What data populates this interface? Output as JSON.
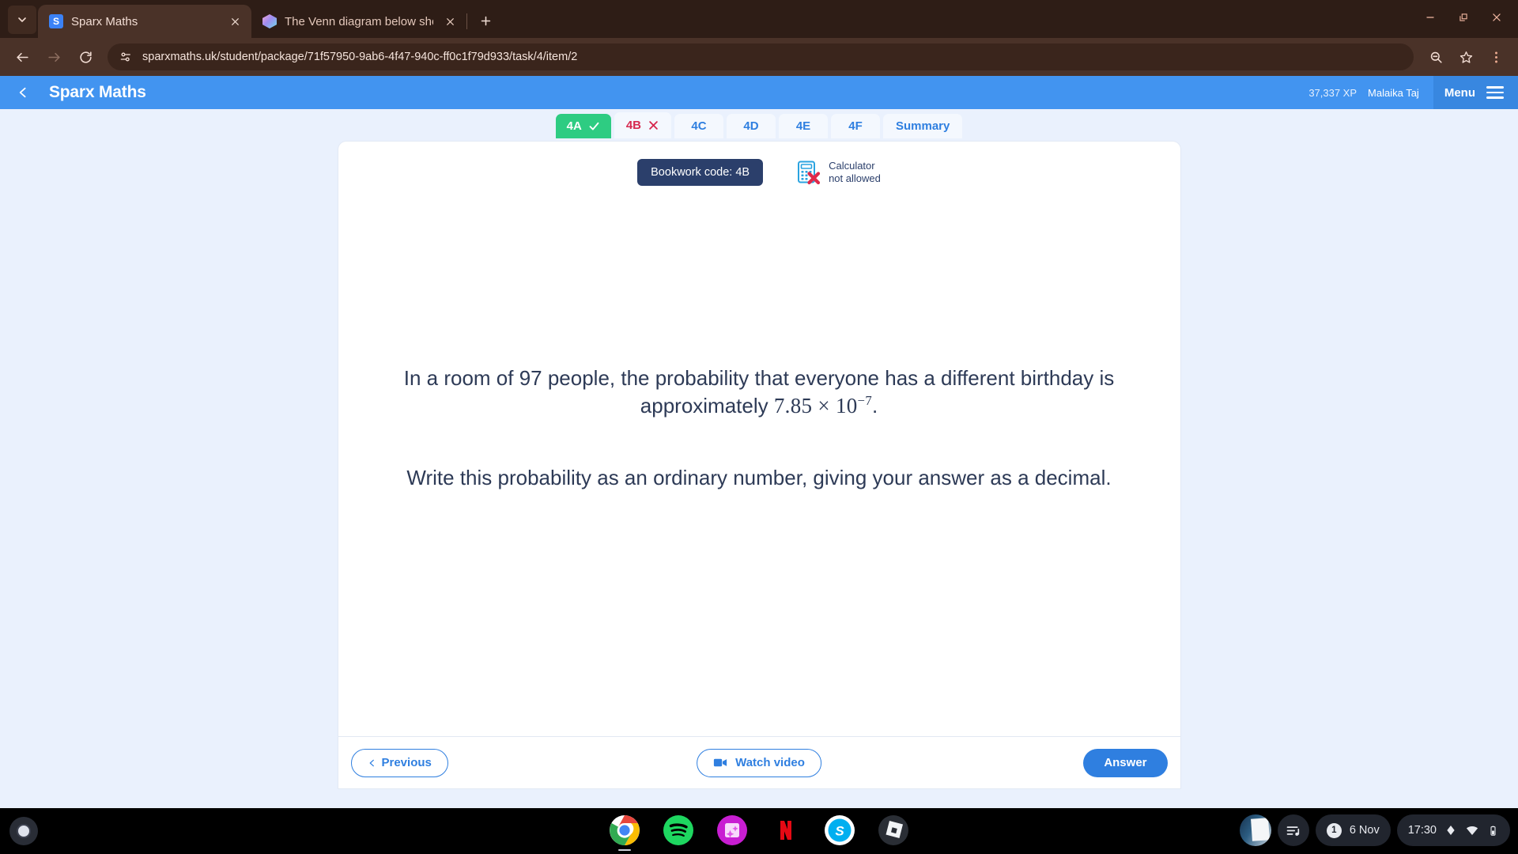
{
  "browser": {
    "tabs": [
      {
        "title": "Sparx Maths",
        "favicon": "sparx-s-icon",
        "active": true
      },
      {
        "title": "The Venn diagram below shows",
        "favicon": "cube-icon",
        "active": false
      }
    ],
    "new_tab_label": "+",
    "url": "sparxmaths.uk/student/package/71f57950-9ab6-4f47-940c-ff0c1f79d933/task/4/item/2",
    "nav": {
      "back": "back-arrow-icon",
      "forward": "forward-arrow-icon",
      "reload": "reload-icon",
      "site_info": "site-settings-icon"
    },
    "actions": {
      "zoom": "search-zoom-icon",
      "bookmark": "star-icon",
      "menu": "three-dot-menu-icon"
    },
    "window_controls": {
      "minimize": "minimize-icon",
      "maximize": "restore-icon",
      "close": "close-icon"
    }
  },
  "app_header": {
    "back_icon": "chevron-left-icon",
    "brand": "Sparx Maths",
    "xp": "37,337 XP",
    "user": "Malaika Taj",
    "menu_label": "Menu",
    "menu_icon": "hamburger-icon"
  },
  "task_tabs": [
    {
      "label": "4A",
      "state": "correct",
      "icon": "check-icon"
    },
    {
      "label": "4B",
      "state": "incorrect",
      "icon": "cross-icon"
    },
    {
      "label": "4C",
      "state": "plain",
      "icon": ""
    },
    {
      "label": "4D",
      "state": "plain",
      "icon": ""
    },
    {
      "label": "4E",
      "state": "plain",
      "icon": ""
    },
    {
      "label": "4F",
      "state": "plain",
      "icon": ""
    },
    {
      "label": "Summary",
      "state": "plain",
      "icon": ""
    }
  ],
  "card": {
    "bookwork_code": "Bookwork code: 4B",
    "calculator_icon": "calculator-not-allowed-icon",
    "calculator_line1": "Calculator",
    "calculator_line2": "not allowed",
    "question_part1": "In a room of 97 people, the probability that everyone has a different birthday is approximately ",
    "question_math_mantissa": "7.85",
    "question_math_times": "×",
    "question_math_base": "10",
    "question_math_exponent": "−7",
    "question_part1_end": ".",
    "question_part2": "Write this probability as an ordinary number, giving your answer as a decimal.",
    "previous_label": "Previous",
    "previous_icon": "chevron-left-icon",
    "watch_video_label": "Watch video",
    "watch_video_icon": "video-camera-icon",
    "answer_label": "Answer"
  },
  "shelf": {
    "launcher_icon": "launcher-icon",
    "apps": [
      {
        "name": "chrome-icon"
      },
      {
        "name": "spotify-icon"
      },
      {
        "name": "photos-icon"
      },
      {
        "name": "netflix-icon"
      },
      {
        "name": "skype-icon"
      },
      {
        "name": "roblox-icon"
      }
    ],
    "tray": {
      "screenshot_thumbnail": "screen-capture-thumbnail",
      "media_icon": "media-playlist-icon",
      "notification_count": "1",
      "date": "6 Nov",
      "time": "17:30",
      "pen_icon": "stylus-icon",
      "wifi_icon": "wifi-icon",
      "battery_icon": "battery-icon"
    }
  },
  "colors": {
    "browser_frame": "#2e1d16",
    "toolbar": "#4a3228",
    "app_blue": "#4294f0",
    "accent_blue": "#2f7fe0",
    "correct_green": "#2ecc82",
    "incorrect_red": "#d6294f",
    "bookwork_navy": "#2b3f6b",
    "page_bg": "#eaf1fd"
  }
}
